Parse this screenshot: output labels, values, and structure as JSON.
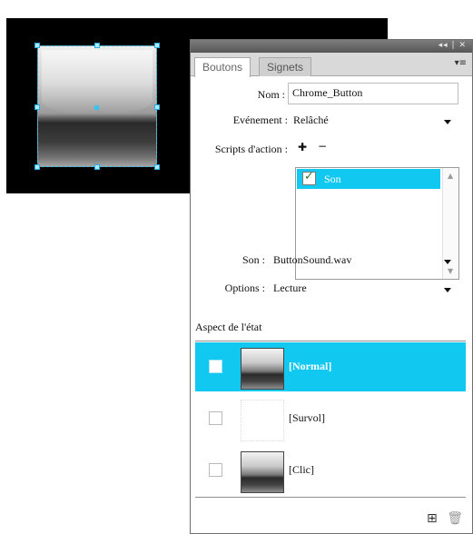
{
  "panel": {
    "tabs": [
      "Boutons",
      "Signets"
    ],
    "window_controls": "◂◂ | ✕",
    "menu_icon": "▾≡"
  },
  "form": {
    "name_label": "Nom :",
    "name_value": "Chrome_Button",
    "event_label": "Evénement :",
    "event_value": "Relâché",
    "scripts_label": "Scripts d'action :",
    "add_icon": "✚",
    "remove_icon": "−",
    "action_item": "Son",
    "sound_label": "Son :",
    "sound_value": "ButtonSound.wav",
    "options_label": "Options :",
    "options_value": "Lecture"
  },
  "state": {
    "section_title": "Aspect de l'état",
    "rows": [
      {
        "label": "[Normal]",
        "selected": true
      },
      {
        "label": "[Survol]",
        "selected": false
      },
      {
        "label": "[Clic]",
        "selected": false
      }
    ]
  },
  "footer": {
    "icons": [
      "new-state-icon",
      "trash-icon"
    ]
  },
  "colors": {
    "selection": "#10c8f0",
    "canvas": "#000000",
    "selection_outline": "#39c3f0"
  }
}
